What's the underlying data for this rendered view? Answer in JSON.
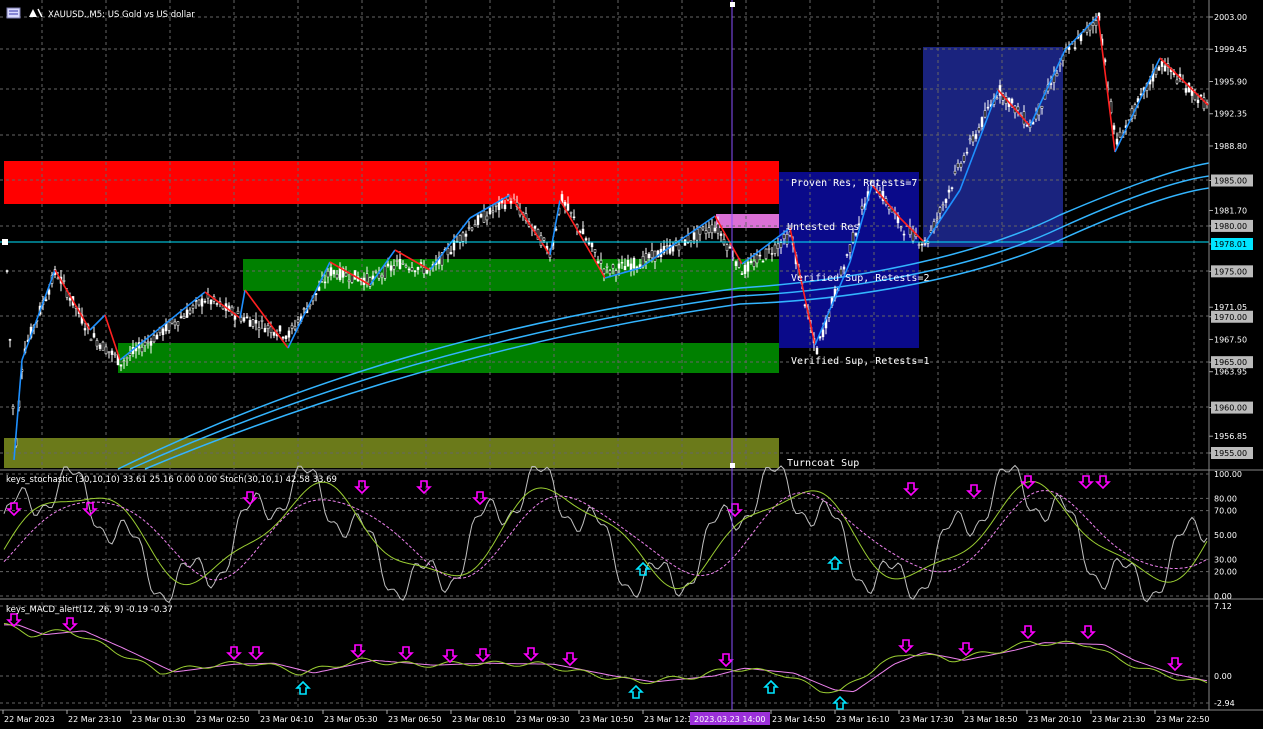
{
  "window": {
    "title": "XAUUSD.,M5: US Gold vs US dollar",
    "symbol": "XAUUSD.",
    "timeframe": "M5",
    "description": "US Gold vs US dollar"
  },
  "price_axis": {
    "labels": [
      "2003.00",
      "1999.45",
      "1995.90",
      "1992.35",
      "1988.80",
      "1985.00",
      "1981.70",
      "1980.00",
      "1978.01",
      "1975.00",
      "1971.05",
      "1970.00",
      "1967.50",
      "1965.00",
      "1963.95",
      "1960.00",
      "1956.85",
      "1955.00"
    ],
    "current_price": "1978.01"
  },
  "zone_labels": {
    "proven_res": "Proven Res, Retests=7",
    "untested_res": "Untested Res",
    "verified_sup_2": "Verified Sup, Retests=2",
    "verified_sup_1": "Verified Sup, Retests=1",
    "turncoat_sup": "Turncoat Sup"
  },
  "stochastic": {
    "header": "keys_stochastic (30,10,10) 33.61 25.16 0.00 0.00 Stoch(30,10,1) 42.58 33.69",
    "levels": [
      "100.00",
      "80.00",
      "70.00",
      "50.00",
      "30.00",
      "20.00",
      "0.00"
    ]
  },
  "macd": {
    "header": "keys_MACD_alert(12, 26, 9) -0.19 -0.37",
    "levels": [
      "7.12",
      "0.00",
      "-2.94"
    ]
  },
  "time_axis": {
    "labels": [
      "22 Mar 2023",
      "22 Mar 23:10",
      "23 Mar 01:30",
      "23 Mar 02:50",
      "23 Mar 04:10",
      "23 Mar 05:30",
      "23 Mar 06:50",
      "23 Mar 08:10",
      "23 Mar 09:30",
      "23 Mar 10:50",
      "23 Mar 12:10",
      "23 Mar 14:50",
      "23 Mar 16:10",
      "23 Mar 17:30",
      "23 Mar 18:50",
      "23 Mar 20:10",
      "23 Mar 21:30",
      "23 Mar 22:50"
    ],
    "cursor_label": "2023.03.23 14:00"
  },
  "colors": {
    "background": "#000000",
    "resistance_zone": "#ff0000",
    "support_zone": "#008000",
    "turncoat_zone": "#6b7a1a",
    "untested_zone": "#da70d6",
    "range_box": "#1a237e",
    "up_swing": "#1e90ff",
    "down_swing": "#ff2020",
    "moving_average": "#33b5ff",
    "price_line": "#00e5ff",
    "signal_arrow_down": "#ff00ff",
    "signal_arrow_up": "#00e5ff",
    "cursor_line": "#8a4fff"
  },
  "icons": {
    "chart_window_icon": "candlestick-chart-icon",
    "trade_icon": "trade-arrows-icon"
  }
}
